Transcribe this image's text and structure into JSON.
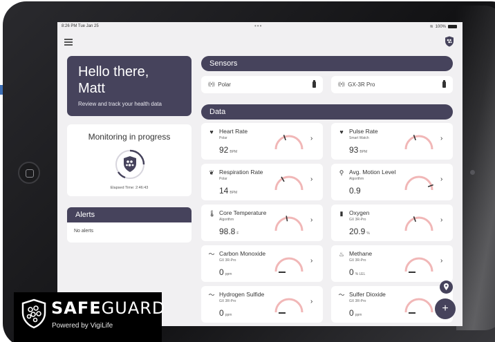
{
  "status_bar": {
    "time": "8:26 PM  Tue Jan 25",
    "dots": "•••",
    "battery": "100%"
  },
  "greeting": {
    "title_line1": "Hello there,",
    "title_line2": "Matt",
    "subtitle": "Review and track your health data"
  },
  "monitoring": {
    "title": "Monitoring in progress",
    "elapsed": "Elapsed Time: 2:46:43"
  },
  "alerts": {
    "title": "Alerts",
    "empty_text": "No alerts"
  },
  "sensors": {
    "title": "Sensors",
    "items": [
      {
        "label": "Polar",
        "icon": "signal-icon"
      },
      {
        "label": "GX-3R Pro",
        "icon": "signal-icon"
      }
    ]
  },
  "data_section": {
    "title": "Data",
    "tiles": [
      {
        "name": "Heart Rate",
        "source": "Polar",
        "value": "92",
        "unit": "BPM",
        "icon": "heart-icon"
      },
      {
        "name": "Pulse Rate",
        "source": "Smart Watch",
        "value": "93",
        "unit": "BPM",
        "icon": "heart-icon"
      },
      {
        "name": "Respiration Rate",
        "source": "Polar",
        "value": "14",
        "unit": "BPM",
        "icon": "lungs-icon"
      },
      {
        "name": "Avg. Motion Level",
        "source": "Algorithm",
        "value": "0.9",
        "unit": "",
        "icon": "runner-icon"
      },
      {
        "name": "Core Temperature",
        "source": "Algorithm",
        "value": "98.8",
        "unit": "F",
        "icon": "thermometer-icon"
      },
      {
        "name": "Oxygen",
        "source": "GX 3R-Pro",
        "value": "20.9",
        "unit": "%",
        "icon": "oxygen-tank-icon"
      },
      {
        "name": "Carbon Monoxide",
        "source": "GX 3R-Pro",
        "value": "0",
        "unit": "ppm",
        "icon": "trend-icon"
      },
      {
        "name": "Methane",
        "source": "GX 3R-Pro",
        "value": "0",
        "unit": "% LEL",
        "icon": "flame-icon"
      },
      {
        "name": "Hydrogen Sulfide",
        "source": "GX 3R-Pro",
        "value": "0",
        "unit": "ppm",
        "icon": "trend-icon"
      },
      {
        "name": "Sulfer Dioxide",
        "source": "GX 3R-Pro",
        "value": "0",
        "unit": "ppm",
        "icon": "trend-icon"
      }
    ]
  },
  "fab": {
    "add_label": "+"
  },
  "brand": {
    "name_bold": "SAFE",
    "name_light": "GUARD",
    "tagline": "Powered by VigiLife"
  },
  "colors": {
    "primary": "#46435c",
    "background": "#f1f0f2",
    "gauge": "#f1b7b7",
    "arrow": "#3d6fb5"
  }
}
